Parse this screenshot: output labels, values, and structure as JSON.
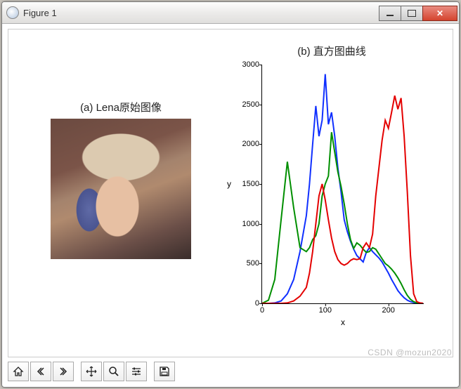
{
  "window": {
    "title": "Figure 1"
  },
  "subplot_a": {
    "title": "(a) Lena原始图像"
  },
  "subplot_b": {
    "title": "(b) 直方图曲线",
    "xlabel": "x",
    "ylabel": "y"
  },
  "toolbar": {
    "home": "home-icon",
    "back": "back-icon",
    "forward": "forward-icon",
    "pan": "pan-icon",
    "zoom": "zoom-icon",
    "config": "config-icon",
    "save": "save-icon"
  },
  "watermark": "CSDN @mozun2020",
  "chart_data": {
    "type": "line",
    "title": "(b) 直方图曲线",
    "xlabel": "x",
    "ylabel": "y",
    "xlim": [
      0,
      256
    ],
    "ylim": [
      0,
      3000
    ],
    "x_ticks": [
      0,
      100,
      200
    ],
    "y_ticks": [
      0,
      500,
      1000,
      1500,
      2000,
      2500,
      3000
    ],
    "x": [
      0,
      10,
      20,
      30,
      40,
      50,
      60,
      70,
      75,
      80,
      85,
      90,
      95,
      100,
      105,
      110,
      115,
      120,
      125,
      130,
      135,
      140,
      145,
      150,
      155,
      160,
      165,
      170,
      175,
      180,
      185,
      190,
      195,
      200,
      205,
      210,
      215,
      220,
      225,
      230,
      235,
      240,
      245,
      250,
      255
    ],
    "series": [
      {
        "name": "blue",
        "color": "#1030ff",
        "values": [
          0,
          0,
          5,
          30,
          120,
          300,
          650,
          1100,
          1500,
          2000,
          2480,
          2100,
          2300,
          2880,
          2250,
          2400,
          2100,
          1700,
          1400,
          1050,
          900,
          780,
          680,
          600,
          560,
          520,
          640,
          700,
          650,
          610,
          570,
          520,
          450,
          380,
          300,
          230,
          160,
          110,
          70,
          40,
          20,
          10,
          5,
          2,
          0
        ]
      },
      {
        "name": "green",
        "color": "#008f00",
        "values": [
          0,
          40,
          300,
          1050,
          1780,
          1200,
          700,
          650,
          700,
          800,
          850,
          1000,
          1350,
          1500,
          1600,
          2150,
          1900,
          1650,
          1470,
          1250,
          1000,
          800,
          690,
          760,
          730,
          680,
          640,
          650,
          700,
          680,
          620,
          560,
          500,
          470,
          430,
          380,
          320,
          250,
          170,
          100,
          50,
          20,
          8,
          2,
          0
        ]
      },
      {
        "name": "red",
        "color": "#e40000",
        "values": [
          0,
          0,
          0,
          0,
          5,
          30,
          90,
          200,
          380,
          650,
          1000,
          1350,
          1500,
          1300,
          1050,
          820,
          650,
          550,
          500,
          480,
          500,
          540,
          560,
          550,
          560,
          700,
          760,
          700,
          870,
          1350,
          1700,
          2050,
          2300,
          2200,
          2400,
          2610,
          2440,
          2580,
          2100,
          1400,
          600,
          120,
          20,
          5,
          0
        ]
      }
    ]
  }
}
